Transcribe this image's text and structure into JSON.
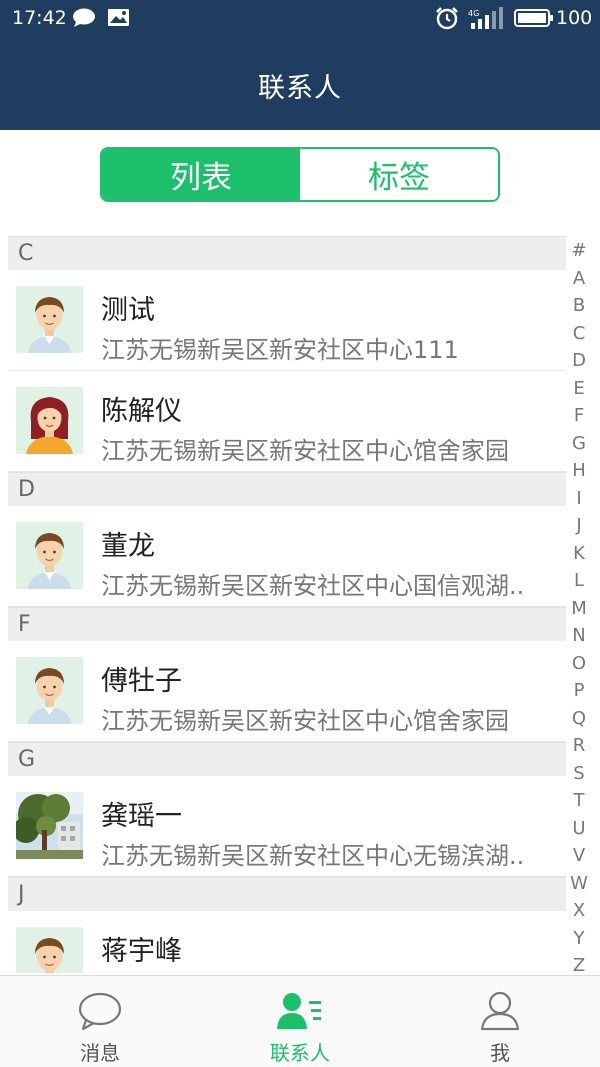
{
  "status_bar": {
    "time": "17:42",
    "network": "4G",
    "battery": "100",
    "icons": [
      "chat-bubble-icon",
      "image-notification-icon",
      "alarm-icon",
      "signal-icon",
      "battery-icon"
    ]
  },
  "header": {
    "title": "联系人"
  },
  "segment": {
    "tabs": [
      "列表",
      "标签"
    ],
    "active_index": 0
  },
  "sections": [
    {
      "letter": "C",
      "contacts": [
        {
          "name": "测试",
          "address": "江苏无锡新吴区新安社区中心111",
          "avatar": "male-avatar"
        },
        {
          "name": "陈解仪",
          "address": "江苏无锡新吴区新安社区中心馆舍家园",
          "avatar": "female-avatar"
        }
      ]
    },
    {
      "letter": "D",
      "contacts": [
        {
          "name": "董龙",
          "address": "江苏无锡新吴区新安社区中心国信观湖..",
          "avatar": "male-avatar"
        }
      ]
    },
    {
      "letter": "F",
      "contacts": [
        {
          "name": "傅牡子",
          "address": "江苏无锡新吴区新安社区中心馆舍家园",
          "avatar": "male-avatar"
        }
      ]
    },
    {
      "letter": "G",
      "contacts": [
        {
          "name": "龚瑶一",
          "address": "江苏无锡新吴区新安社区中心无锡滨湖..",
          "avatar": "photo-avatar"
        }
      ]
    },
    {
      "letter": "J",
      "contacts": [
        {
          "name": "蒋宇峰",
          "address": "",
          "avatar": "male-avatar"
        }
      ]
    }
  ],
  "alphabet_index": [
    "#",
    "A",
    "B",
    "C",
    "D",
    "E",
    "F",
    "G",
    "H",
    "I",
    "J",
    "K",
    "L",
    "M",
    "N",
    "O",
    "P",
    "Q",
    "R",
    "S",
    "T",
    "U",
    "V",
    "W",
    "X",
    "Y",
    "Z"
  ],
  "bottom_nav": [
    {
      "label": "消息",
      "icon": "message-bubble-icon",
      "active": false
    },
    {
      "label": "联系人",
      "icon": "contacts-icon",
      "active": true
    },
    {
      "label": "我",
      "icon": "profile-icon",
      "active": false
    }
  ],
  "colors": {
    "header_bg": "#1e3d5f",
    "accent": "#1cbf6b"
  }
}
